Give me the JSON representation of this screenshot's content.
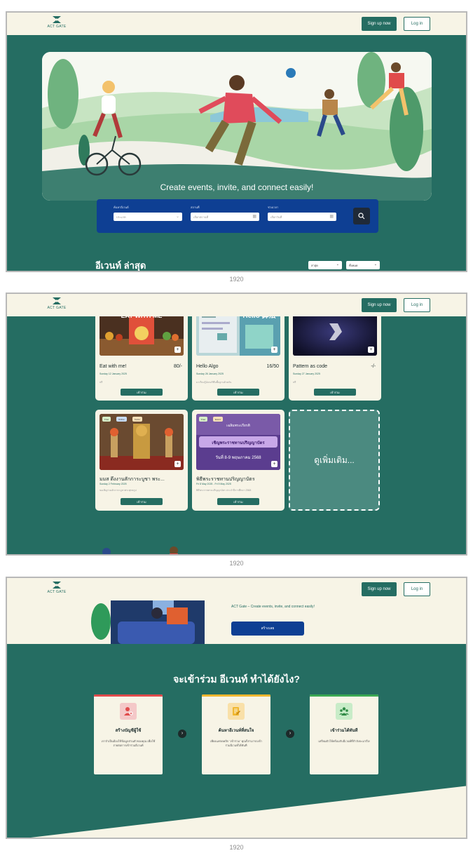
{
  "brand": {
    "name": "ACT GATE"
  },
  "nav": {
    "signup_label": "Sign up now",
    "login_label": "Log in"
  },
  "hero": {
    "headline": "Create events, invite, and connect easily!"
  },
  "search": {
    "field1_label": "ค้นหาอีเวนต์",
    "field1_value": "ประเภท",
    "field2_label": "สถานที่",
    "field2_value": "เลือกสถานที่",
    "field3_label": "ช่วงเวลา",
    "field3_value": "เลือกวันที่"
  },
  "latest": {
    "title": "อีเวนท์ ล่าสุด",
    "sort1": "ล่าสุด",
    "sort2": "ทั้งหมด"
  },
  "events": [
    {
      "title": "Eat with me!",
      "price": "80/-",
      "date": "Sunday 12 January 2025",
      "desc": "ฟรี",
      "join": "เข้าร่วม",
      "img_text": "EAT WITH ME"
    },
    {
      "title": "Hello Algo",
      "price": "16/50",
      "date": "Sunday 26 January 2025",
      "desc": "มาเรียนรู้อัลกอริทึมพื้นฐานด้วยกัน",
      "join": "เข้าร่วม",
      "img_text": "Hello 算法"
    },
    {
      "title": "Pattern as code",
      "price": "-/-",
      "date": "Sunday 27 January 2025",
      "desc": "ฟรี",
      "join": "เข้าร่วม",
      "img_text": ""
    },
    {
      "title": "มมส ตึงงานสักการะบูชา พระ...",
      "price": "",
      "date": "Sunday 2 February 2025",
      "desc": "ขอเชิญร่วมสักการะบูชาพระพุทธรูป",
      "join": "เข้าร่วม",
      "tags": [
        "Free",
        "Online",
        "Kunto"
      ]
    },
    {
      "title": "พิธีพระราชทานปริญญาบัตร",
      "price": "",
      "date": "Fri 8 May 2025 - Fri 9 May 2025",
      "desc": "พิธีพระราชทานปริญญาบัตร ประจำปีการศึกษา 2568",
      "join": "เข้าร่วม",
      "tags": [
        "Free",
        "Event"
      ],
      "img_line1": "เฉลิมพระเกียรติ",
      "img_line2": "เชิญพระราชทานปริญญาบัตร",
      "img_line3": "วันที่ 8-9 พฤษภาคม 2568"
    }
  ],
  "see_more": "ดูเพิ่มเติม...",
  "promo": {
    "tagline": "ACT Gate – Create events, invite, and connect easily!",
    "create_label": "สร้างเลย"
  },
  "how": {
    "title": "จะเข้าร่วม อีเวนท์ ทำได้ยังไง?",
    "steps": [
      {
        "title": "สร้างบัญชีผู้ใช้",
        "desc": "เราจำเป็นต้องใช้ข้อมูลส่วนตัวของคุณ เพื่อใช้ง่ายต่อการเข้าร่วมอีเวนท์",
        "color": "#e04b4b"
      },
      {
        "title": "ค้นหาอีเวนท์ที่สนใจ",
        "desc": "เพียงแค่กดคลิก \"เข้าร่วม\" คุณก็สามารถเข้าร่วมอีเวนท์ได้ทันที",
        "color": "#f0b72f"
      },
      {
        "title": "เข้าร่วมได้ทันที",
        "desc": "เตรียมตัวให้พร้อมกับอีเวนท์ที่กำลังจะมาถึง!",
        "color": "#3aa853"
      }
    ]
  },
  "frame_width_label": "1920"
}
